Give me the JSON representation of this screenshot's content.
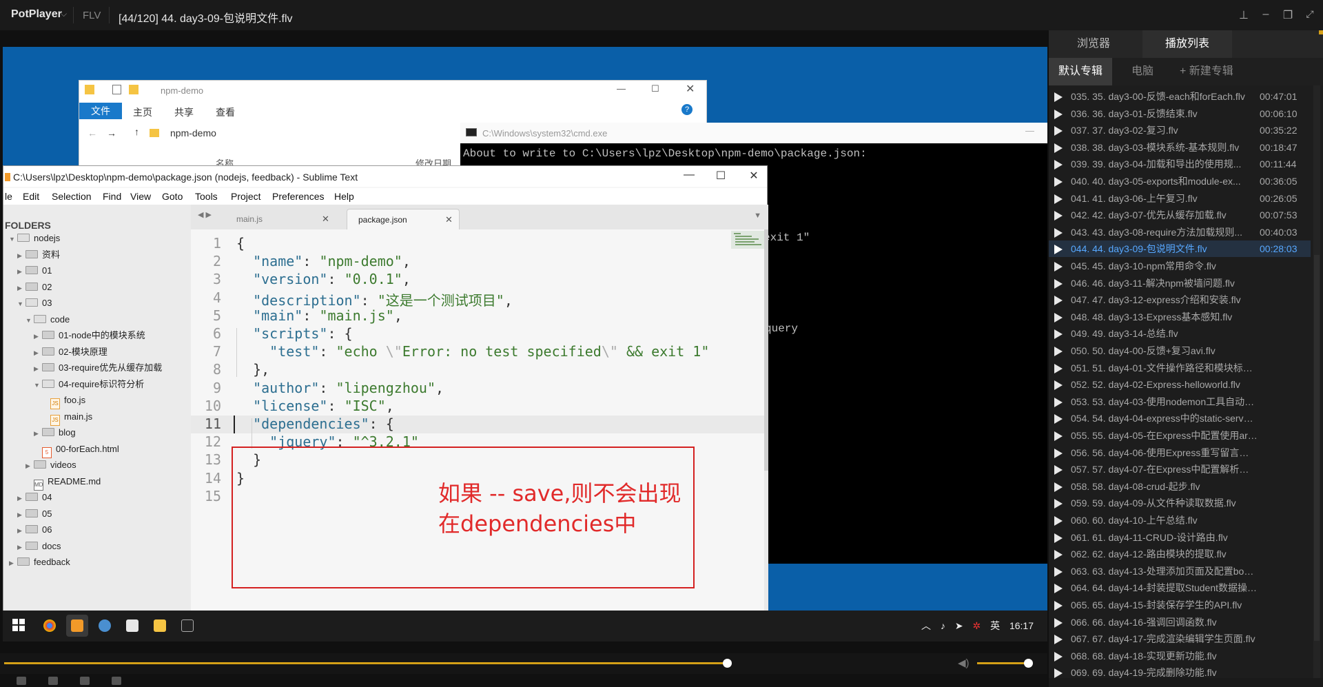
{
  "player": {
    "name": "PotPlayer",
    "format": "FLV",
    "title": "[44/120] 44. day3-09-包说明文件.flv"
  },
  "explorer": {
    "title": "npm-demo",
    "ribbon": {
      "file": "文件",
      "home": "主页",
      "share": "共享",
      "view": "查看"
    },
    "address": "npm-demo",
    "col_name": "名称",
    "col_date": "修改日期"
  },
  "cmd": {
    "title": "C:\\Windows\\system32\\cmd.exe",
    "line1": "About to write to C:\\Users\\lpz\\Desktop\\npm-demo\\package.json:",
    "frag1": "exit 1\"",
    "frag2": "query"
  },
  "sublime": {
    "title": "C:\\Users\\lpz\\Desktop\\npm-demo\\package.json (nodejs, feedback) - Sublime Text",
    "menu": [
      "le",
      "Edit",
      "Selection",
      "Find",
      "View",
      "Goto",
      "Tools",
      "Project",
      "Preferences",
      "Help"
    ],
    "sidebar_header": "FOLDERS",
    "tree": [
      {
        "label": "nodejs",
        "depth": 0,
        "type": "folder",
        "open": true
      },
      {
        "label": "资料",
        "depth": 1,
        "type": "folder",
        "open": false
      },
      {
        "label": "01",
        "depth": 1,
        "type": "folder",
        "open": false
      },
      {
        "label": "02",
        "depth": 1,
        "type": "folder",
        "open": false
      },
      {
        "label": "03",
        "depth": 1,
        "type": "folder",
        "open": true
      },
      {
        "label": "code",
        "depth": 2,
        "type": "folder",
        "open": true
      },
      {
        "label": "01-node中的模块系统",
        "depth": 3,
        "type": "folder",
        "open": false
      },
      {
        "label": "02-模块原理",
        "depth": 3,
        "type": "folder",
        "open": false
      },
      {
        "label": "03-require优先从缓存加载",
        "depth": 3,
        "type": "folder",
        "open": false
      },
      {
        "label": "04-require标识符分析",
        "depth": 3,
        "type": "folder",
        "open": true
      },
      {
        "label": "foo.js",
        "depth": 4,
        "type": "js"
      },
      {
        "label": "main.js",
        "depth": 4,
        "type": "js"
      },
      {
        "label": "blog",
        "depth": 3,
        "type": "folder",
        "open": false
      },
      {
        "label": "00-forEach.html",
        "depth": 3,
        "type": "html"
      },
      {
        "label": "videos",
        "depth": 2,
        "type": "folder",
        "open": false
      },
      {
        "label": "README.md",
        "depth": 2,
        "type": "md"
      },
      {
        "label": "04",
        "depth": 1,
        "type": "folder",
        "open": false
      },
      {
        "label": "05",
        "depth": 1,
        "type": "folder",
        "open": false
      },
      {
        "label": "06",
        "depth": 1,
        "type": "folder",
        "open": false
      },
      {
        "label": "docs",
        "depth": 1,
        "type": "folder",
        "open": false
      },
      {
        "label": "feedback",
        "depth": 0,
        "type": "folder",
        "open": false
      }
    ],
    "tabs": [
      {
        "label": "main.js",
        "active": false
      },
      {
        "label": "package.json",
        "active": true
      }
    ],
    "current_line": 11,
    "code_lines": [
      "{",
      "  \"name\": \"npm-demo\",",
      "  \"version\": \"0.0.1\",",
      "  \"description\": \"这是一个测试项目\",",
      "  \"main\": \"main.js\",",
      "  \"scripts\": {",
      "    \"test\": \"echo \\\"Error: no test specified\\\" && exit 1\"",
      "  },",
      "  \"author\": \"lipengzhou\",",
      "  \"license\": \"ISC\",",
      "  \"dependencies\": {",
      "    \"jquery\": \"^3.2.1\"",
      "  }",
      "}",
      ""
    ]
  },
  "annotation": {
    "line1": "如果 -- save,则不会出现",
    "line2": "在dependencies中",
    "color": "#e12a2a"
  },
  "taskbar": {
    "ime": "英",
    "time": "16:17"
  },
  "playlist": {
    "tabs": {
      "browser": "浏览器",
      "playlist": "播放列表"
    },
    "sub_tabs": {
      "default": "默认专辑",
      "pc": "电脑",
      "new": "+ 新建专辑"
    },
    "current_index": 9,
    "items": [
      {
        "name": "035. 35. day3-00-反馈-each和forEach.flv",
        "duration": "00:47:01"
      },
      {
        "name": "036. 36. day3-01-反馈结束.flv",
        "duration": "00:06:10"
      },
      {
        "name": "037. 37. day3-02-复习.flv",
        "duration": "00:35:22"
      },
      {
        "name": "038. 38. day3-03-模块系统-基本规则.flv",
        "duration": "00:18:47"
      },
      {
        "name": "039. 39. day3-04-加载和导出的使用规...",
        "duration": "00:11:44"
      },
      {
        "name": "040. 40. day3-05-exports和module-ex...",
        "duration": "00:36:05"
      },
      {
        "name": "041. 41. day3-06-上午复习.flv",
        "duration": "00:26:05"
      },
      {
        "name": "042. 42. day3-07-优先从缓存加载.flv",
        "duration": "00:07:53"
      },
      {
        "name": "043. 43. day3-08-require方法加载规则...",
        "duration": "00:40:03"
      },
      {
        "name": "044. 44. day3-09-包说明文件.flv",
        "duration": "00:28:03"
      },
      {
        "name": "045. 45. day3-10-npm常用命令.flv",
        "duration": ""
      },
      {
        "name": "046. 46. day3-11-解决npm被墙问题.flv",
        "duration": ""
      },
      {
        "name": "047. 47. day3-12-express介绍和安装.flv",
        "duration": ""
      },
      {
        "name": "048. 48. day3-13-Express基本感知.flv",
        "duration": ""
      },
      {
        "name": "049. 49. day3-14-总结.flv",
        "duration": ""
      },
      {
        "name": "050. 50. day4-00-反馈+复习avi.flv",
        "duration": ""
      },
      {
        "name": "051. 51. day4-01-文件操作路径和模块标识路...",
        "duration": ""
      },
      {
        "name": "052. 52. day4-02-Express-helloworld.flv",
        "duration": ""
      },
      {
        "name": "053. 53. day4-03-使用nodemon工具自动重启...",
        "duration": ""
      },
      {
        "name": "054. 54. day4-04-express中的static-server静态...",
        "duration": ""
      },
      {
        "name": "055. 55. day4-05-在Express中配置使用art-temp...",
        "duration": ""
      },
      {
        "name": "056. 56. day4-06-使用Express重写留言本案例.flv",
        "duration": ""
      },
      {
        "name": "057. 57. day4-07-在Express中配置解析表单post...",
        "duration": ""
      },
      {
        "name": "058. 58. day4-08-crud-起步.flv",
        "duration": ""
      },
      {
        "name": "059. 59. day4-09-从文件种读取数据.flv",
        "duration": ""
      },
      {
        "name": "060. 60. day4-10-上午总结.flv",
        "duration": ""
      },
      {
        "name": "061. 61. day4-11-CRUD-设计路由.flv",
        "duration": ""
      },
      {
        "name": "062. 62. day4-12-路由模块的提取.flv",
        "duration": ""
      },
      {
        "name": "063. 63. day4-13-处理添加页面及配置body-par...",
        "duration": ""
      },
      {
        "name": "064. 64. day4-14-封装提取Student数据操作模...",
        "duration": ""
      },
      {
        "name": "065. 65. day4-15-封装保存学生的API.flv",
        "duration": ""
      },
      {
        "name": "066. 66. day4-16-强调回调函数.flv",
        "duration": ""
      },
      {
        "name": "067. 67. day4-17-完成渲染编辑学生页面.flv",
        "duration": ""
      },
      {
        "name": "068. 68. day4-18-实现更新功能.flv",
        "duration": ""
      },
      {
        "name": "069. 69. day4-19-完成删除功能.flv",
        "duration": ""
      }
    ]
  },
  "playback": {
    "progress": 0.67,
    "volume": 0.93,
    "accent": "#d5a017"
  }
}
